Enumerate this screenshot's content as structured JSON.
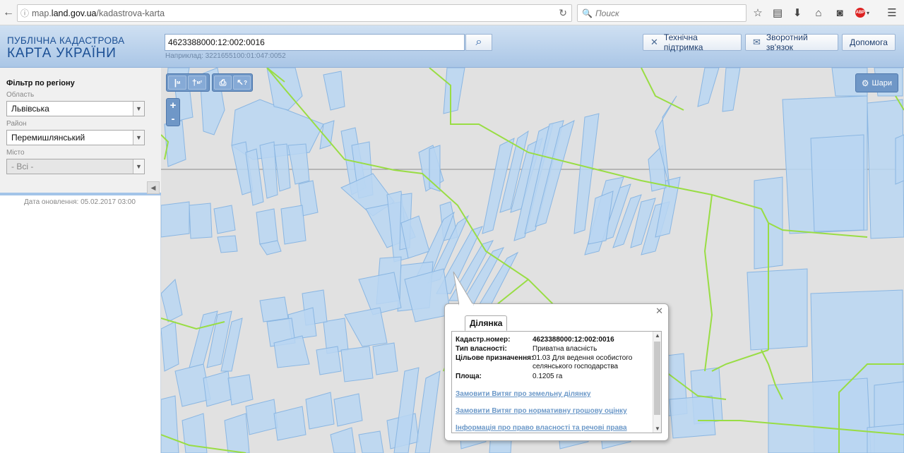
{
  "browser": {
    "url_prefix": "map.",
    "url_host": "land.gov.ua",
    "url_path": "/kadastrova-karta",
    "search_placeholder": "Поиск",
    "abp_label": "ABP"
  },
  "header": {
    "logo_line1": "ПУБЛІЧНА КАДАСТРОВА",
    "logo_line2": "КАРТА УКРАЇНИ",
    "search_value": "4623388000:12:002:0016",
    "search_example": "Наприклад: 3221655100:01:047:0052",
    "btn_support": "Технічна підтримка",
    "btn_feedback": "Зворотний зв'язок",
    "btn_help": "Допомога"
  },
  "sidebar": {
    "title": "Фільтр по регіону",
    "oblast_label": "Область",
    "oblast_value": "Львівська",
    "rayon_label": "Район",
    "rayon_value": "Перемишлянський",
    "misto_label": "Місто",
    "misto_value": "- Всі -",
    "update_text": "Дата оновлення: 05.02.2017 03:00"
  },
  "map": {
    "layers_label": "Шари",
    "tool_ruler_label": "м",
    "tool_area_label": "м²",
    "tool_identify_label": "?"
  },
  "popup": {
    "tab_label": "Ділянка",
    "rows": [
      {
        "label": "Кадастр.номер:",
        "value": "4623388000:12:002:0016"
      },
      {
        "label": "Тип власності:",
        "value": "Приватна власність"
      },
      {
        "label": "Цільове призначення:",
        "value": "01.03 Для ведення особистого селянського господарства"
      },
      {
        "label": "Площа:",
        "value": "0.1205 га"
      }
    ],
    "link_extract": "Замовити Витяг про земельну ділянку",
    "link_valuation": "Замовити Витяг про нормативну грошову оцінку",
    "link_rights": "Інформація про право власності та речові права"
  },
  "colors": {
    "parcel_fill": "#b8d6f2",
    "parcel_stroke": "#8ab6e2",
    "boundary": "#99dd44",
    "map_bg": "#e1e1e1"
  }
}
